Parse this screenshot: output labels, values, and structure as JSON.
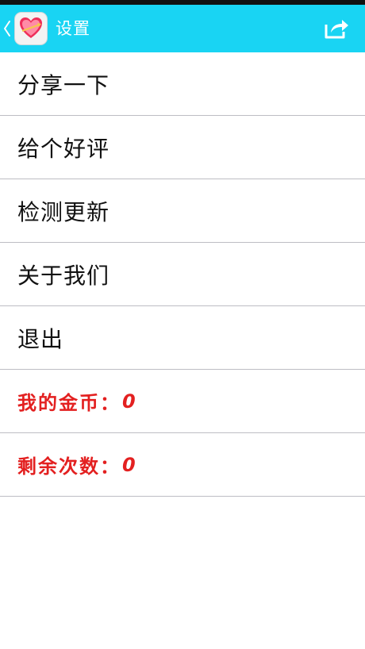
{
  "header": {
    "title": "设置",
    "back_icon": "chevron-left-icon",
    "app_icon": "heart-icon",
    "share_icon": "share-icon",
    "color": "#19d4f3"
  },
  "menu": {
    "items": [
      {
        "label": "分享一下"
      },
      {
        "label": "给个好评"
      },
      {
        "label": "检测更新"
      },
      {
        "label": "关于我们"
      },
      {
        "label": "退出"
      }
    ]
  },
  "stats": {
    "coins_label": "我的金币：",
    "coins_value": "0",
    "remaining_label": "剩余次数：",
    "remaining_value": "0",
    "color": "#e32020"
  }
}
